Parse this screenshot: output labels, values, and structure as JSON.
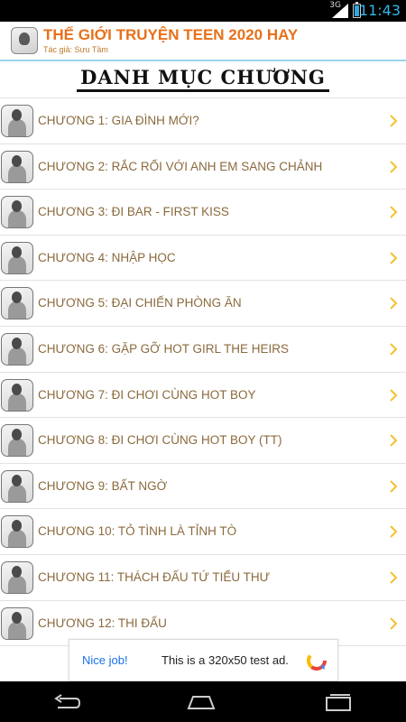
{
  "status_bar": {
    "network": "3G",
    "time": "11:43",
    "battery_level": 0.85
  },
  "header": {
    "title": "THẾ GIỚI TRUYỆN TEEN 2020 HAY",
    "author": "Tác giả: Sưu Tầm"
  },
  "section_title": "DANH MỤC CHƯƠNG",
  "chapters": [
    {
      "label": "CHƯƠNG 1: GIA ĐÌNH MỚI?"
    },
    {
      "label": "CHƯƠNG 2: RẮC RỐI VỚI ANH EM SANG CHẢNH"
    },
    {
      "label": "CHƯƠNG 3: ĐI BAR - FIRST KISS"
    },
    {
      "label": "CHƯƠNG 4: NHẬP HỌC"
    },
    {
      "label": "CHƯƠNG 5: ĐẠI CHIẾN PHÒNG ĂN"
    },
    {
      "label": "CHƯƠNG 6: GẶP GỠ HOT GIRL THE HEIRS"
    },
    {
      "label": "CHƯƠNG 7: ĐI CHƠI CÙNG HOT BOY"
    },
    {
      "label": "CHƯƠNG 8: ĐI CHƠI CÙNG HOT BOY (TT)"
    },
    {
      "label": "CHƯƠNG 9: BẤT NGỜ"
    },
    {
      "label": "CHƯƠNG 10: TỎ TÌNH LÀ TỈNH TÒ"
    },
    {
      "label": "CHƯƠNG 11: THÁCH ĐẤU TỨ TIỂU THƯ"
    },
    {
      "label": "CHƯƠNG 12: THI ĐẤU"
    }
  ],
  "ad": {
    "nice": "Nice job!",
    "text": "This is a 320x50 test ad."
  },
  "colors": {
    "title": "#e8701a",
    "chapter_text": "#8a6a3d",
    "chevron": "#f2c12e",
    "accent": "#33b5e5"
  },
  "icons": {
    "chapter_thumb": "chapter-thumbnail",
    "chevron": "chevron-right-icon"
  }
}
